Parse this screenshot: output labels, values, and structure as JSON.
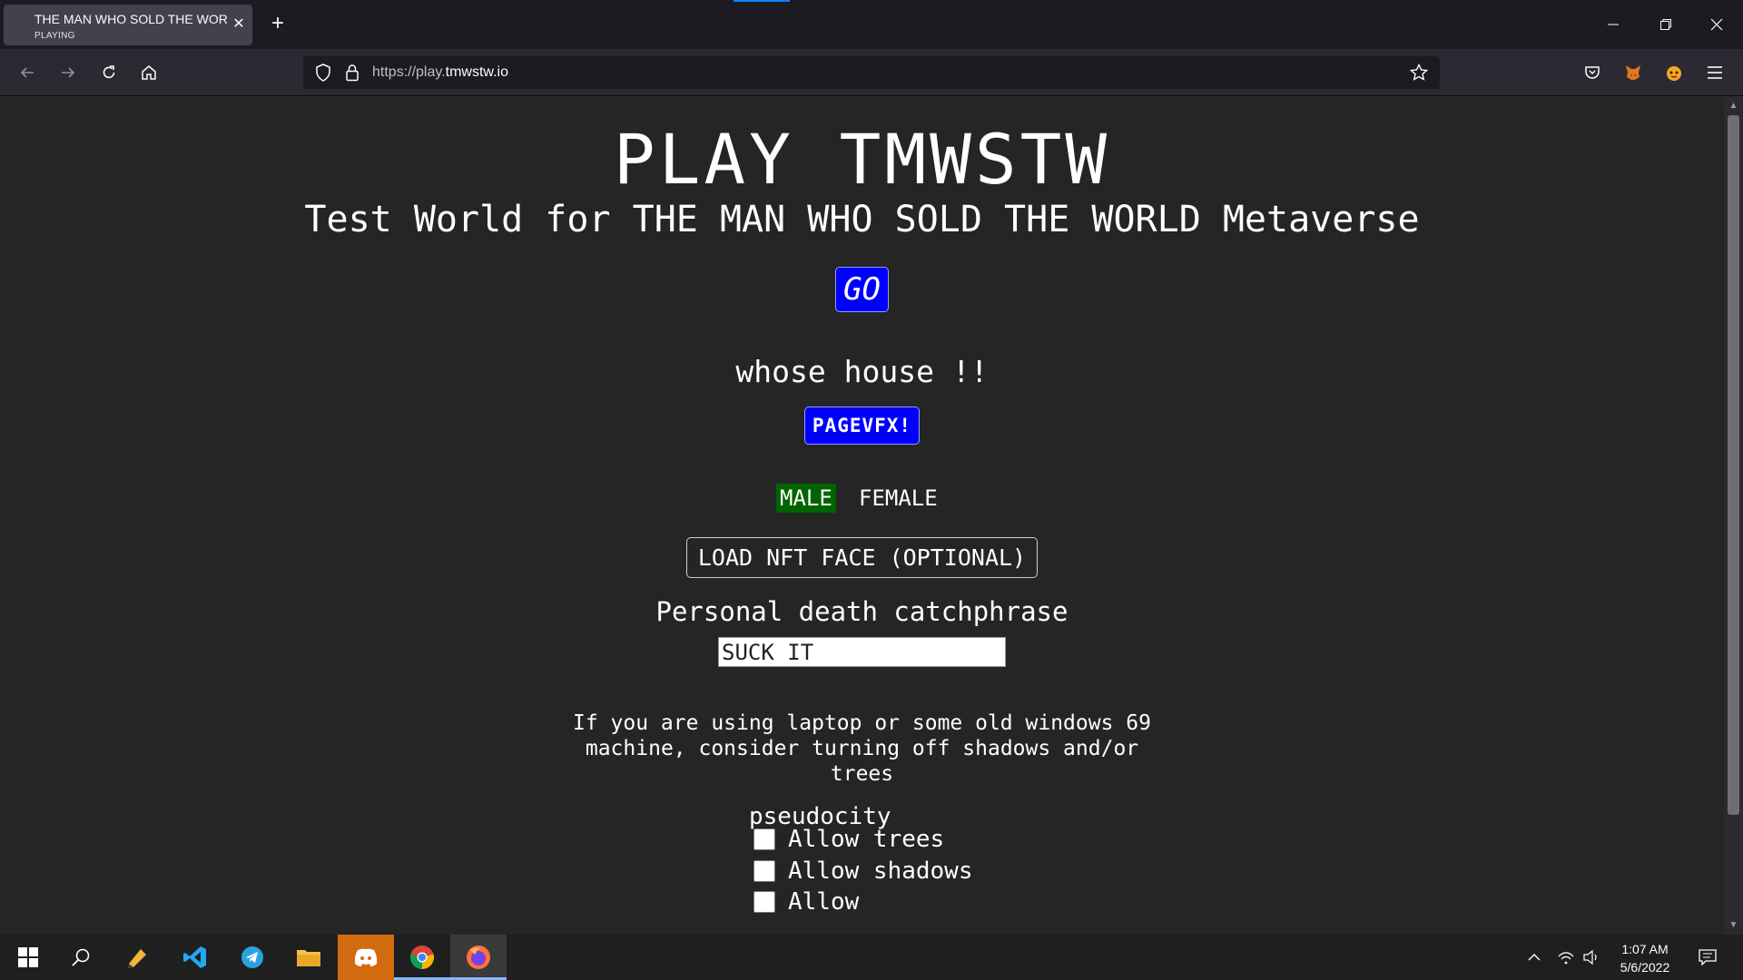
{
  "browser": {
    "tab": {
      "title": "THE MAN WHO SOLD THE WORLD",
      "status": "PLAYING"
    },
    "url": {
      "prefix": "https://play.",
      "domain": "tmwstw.io"
    }
  },
  "page": {
    "title": "PLAY TMWSTW",
    "subtitle": "Test World for THE MAN WHO SOLD THE WORLD Metaverse",
    "go_label": "GO",
    "whose": "whose house !!",
    "pagevfx_label": "PAGEVFX!",
    "gender": {
      "male": "MALE",
      "female": "FEMALE",
      "selected": "MALE"
    },
    "nft_label": "LOAD NFT FACE (OPTIONAL)",
    "catchphrase_label": "Personal death catchphrase",
    "catchphrase_value": "SUCK IT",
    "warning": "If you are using laptop or some old windows 69 machine, consider turning off shadows and/or trees",
    "options": [
      {
        "label": "Allow trees",
        "checked": false
      },
      {
        "label": "Allow shadows",
        "checked": false
      },
      {
        "label": "Allow",
        "checked": false
      }
    ],
    "options_overflow": "pseudocity"
  },
  "taskbar": {
    "time": "1:07 AM",
    "date": "5/6/2022"
  },
  "colors": {
    "accent_blue": "#0000ff",
    "male_green": "#006400",
    "page_bg": "#252526"
  }
}
